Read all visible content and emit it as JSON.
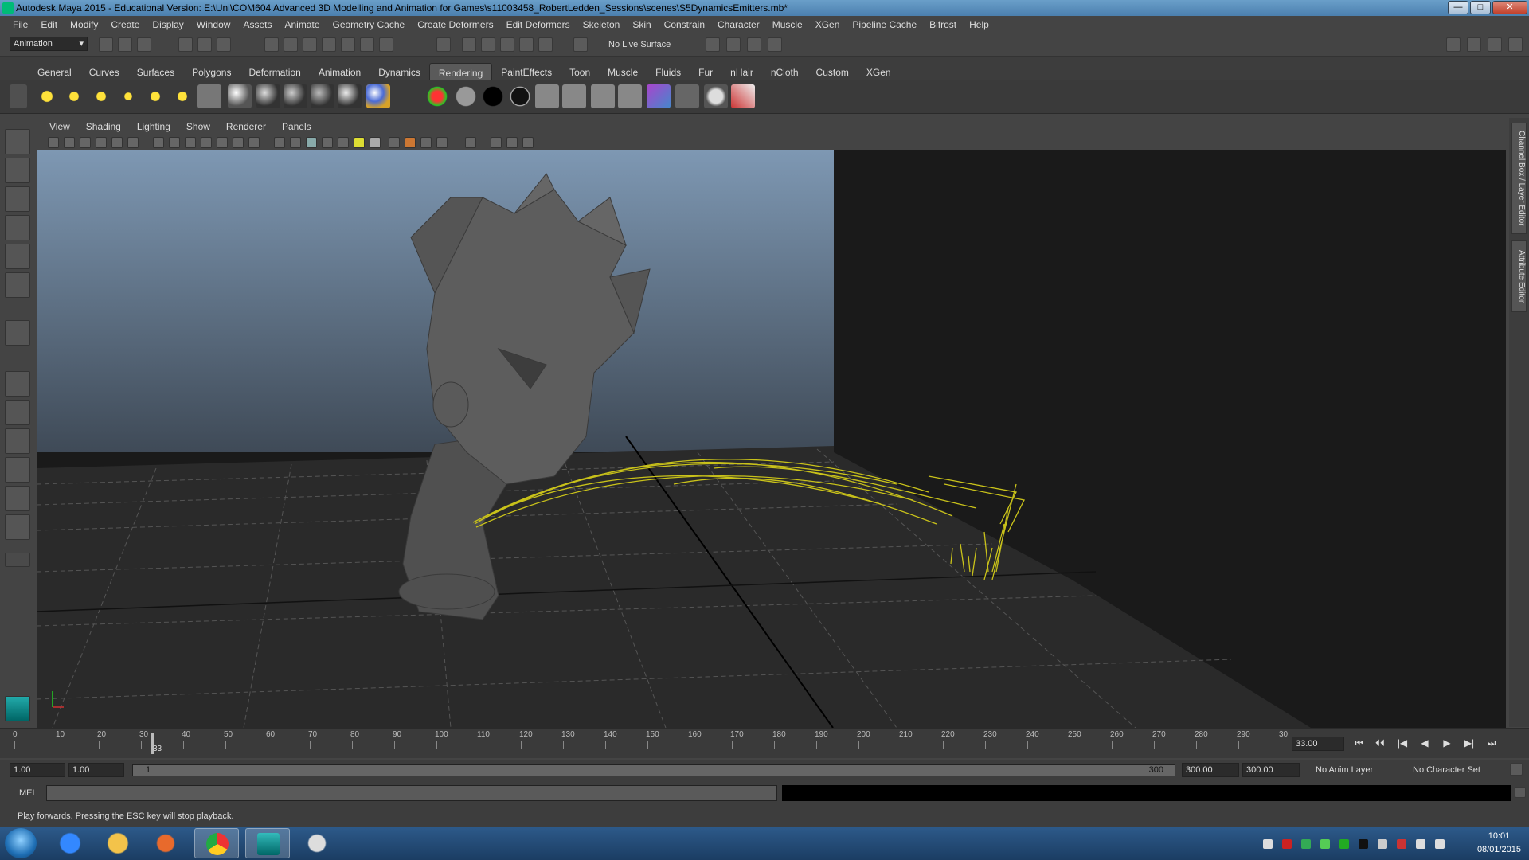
{
  "window": {
    "title": "Autodesk Maya 2015 - Educational Version: E:\\Uni\\COM604 Advanced 3D Modelling and Animation for Games\\s11003458_RobertLedden_Sessions\\scenes\\S5DynamicsEmitters.mb*",
    "minimize": "—",
    "maximize": "□",
    "close": "✕"
  },
  "menubar": [
    "File",
    "Edit",
    "Modify",
    "Create",
    "Display",
    "Window",
    "Assets",
    "Animate",
    "Geometry Cache",
    "Create Deformers",
    "Edit Deformers",
    "Skeleton",
    "Skin",
    "Constrain",
    "Character",
    "Muscle",
    "XGen",
    "Pipeline Cache",
    "Bifrost",
    "Help"
  ],
  "statusline": {
    "mode": "Animation",
    "live_surface": "No Live Surface"
  },
  "shelf": {
    "tabs": [
      "General",
      "Curves",
      "Surfaces",
      "Polygons",
      "Deformation",
      "Animation",
      "Dynamics",
      "Rendering",
      "PaintEffects",
      "Toon",
      "Muscle",
      "Fluids",
      "Fur",
      "nHair",
      "nCloth",
      "Custom",
      "XGen"
    ],
    "active_tab": "Rendering"
  },
  "panel_menu": [
    "View",
    "Shading",
    "Lighting",
    "Show",
    "Renderer",
    "Panels"
  ],
  "sidebar_tabs": [
    "Channel Box / Layer Editor",
    "Attribute Editor"
  ],
  "timeslider": {
    "ticks": [
      "0",
      "10",
      "20",
      "30",
      "40",
      "50",
      "60",
      "70",
      "80",
      "90",
      "100",
      "110",
      "120",
      "130",
      "140",
      "150",
      "160",
      "170",
      "180",
      "190",
      "200",
      "210",
      "220",
      "230",
      "240",
      "250",
      "260",
      "270",
      "280",
      "290",
      "30"
    ],
    "current_frame_marker": "33",
    "current_frame": "33.00",
    "playback_buttons": [
      "⏮",
      "⏴⏴",
      "|◀",
      "◀",
      "▶",
      "▶|",
      "⏭"
    ]
  },
  "range": {
    "start": "1.00",
    "playback_start": "1.00",
    "range_start_label": "1",
    "range_end_label": "300",
    "playback_end": "300.00",
    "end": "300.00",
    "anim_layer": "No Anim Layer",
    "character_set": "No Character Set"
  },
  "command": {
    "label": "MEL"
  },
  "helpline": {
    "text": "Play forwards. Pressing the ESC key will stop playback."
  },
  "taskbar": {
    "time": "10:01",
    "date": "08/01/2015"
  },
  "colors": {
    "particles": "#c9c21a",
    "maya_bg": "#444444",
    "viewport_sky_top": "#7e98b3",
    "viewport_sky_bottom": "#3f4a57"
  }
}
